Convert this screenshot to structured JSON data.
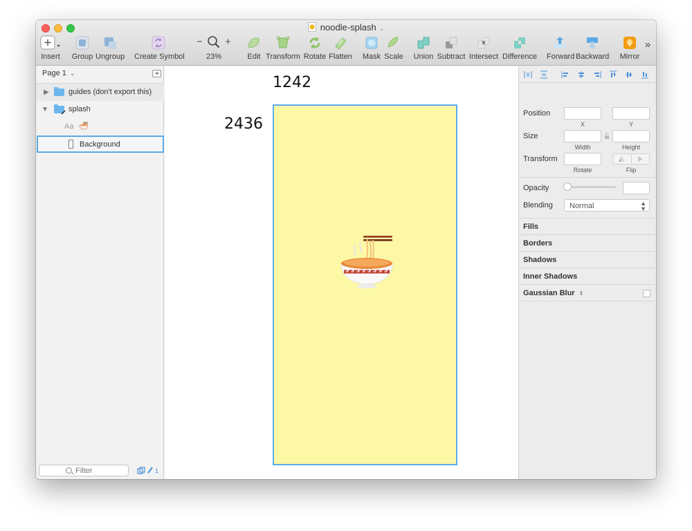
{
  "window": {
    "title": "noodle-splash"
  },
  "toolbar": {
    "insert": "Insert",
    "group": "Group",
    "ungroup": "Ungroup",
    "create_symbol": "Create Symbol",
    "zoom_minus": "−",
    "zoom_plus": "+",
    "zoom_level": "23%",
    "edit": "Edit",
    "transform": "Transform",
    "rotate": "Rotate",
    "flatten": "Flatten",
    "mask": "Mask",
    "scale": "Scale",
    "union": "Union",
    "subtract": "Subtract",
    "intersect": "Intersect",
    "difference": "Difference",
    "forward": "Forward",
    "backward": "Backward",
    "mirror": "Mirror",
    "overflow": "»"
  },
  "layers": {
    "page_label": "Page 1",
    "items": [
      {
        "label": "guides (don't export this)"
      },
      {
        "label": "splash"
      },
      {
        "label": "Aa"
      },
      {
        "label": "Background"
      }
    ],
    "filter_placeholder": "Filter",
    "filter_count": "1"
  },
  "canvas": {
    "width_label": "1242",
    "height_label": "2436",
    "artboard_color": "#fdf8a6"
  },
  "inspector": {
    "position_label": "Position",
    "x_label": "X",
    "y_label": "Y",
    "size_label": "Size",
    "width_label": "Width",
    "height_label": "Height",
    "transform_label": "Transform",
    "rotate_label": "Rotate",
    "flip_label": "Flip",
    "opacity_label": "Opacity",
    "blending_label": "Blending",
    "blending_value": "Normal",
    "fills": "Fills",
    "borders": "Borders",
    "shadows": "Shadows",
    "inner_shadows": "Inner Shadows",
    "gaussian_blur": "Gaussian Blur"
  },
  "colors": {
    "selection_blue": "#5aa9e6",
    "folder_blue": "#6eb6ee",
    "artboard_yellow": "#fdf8a6"
  }
}
